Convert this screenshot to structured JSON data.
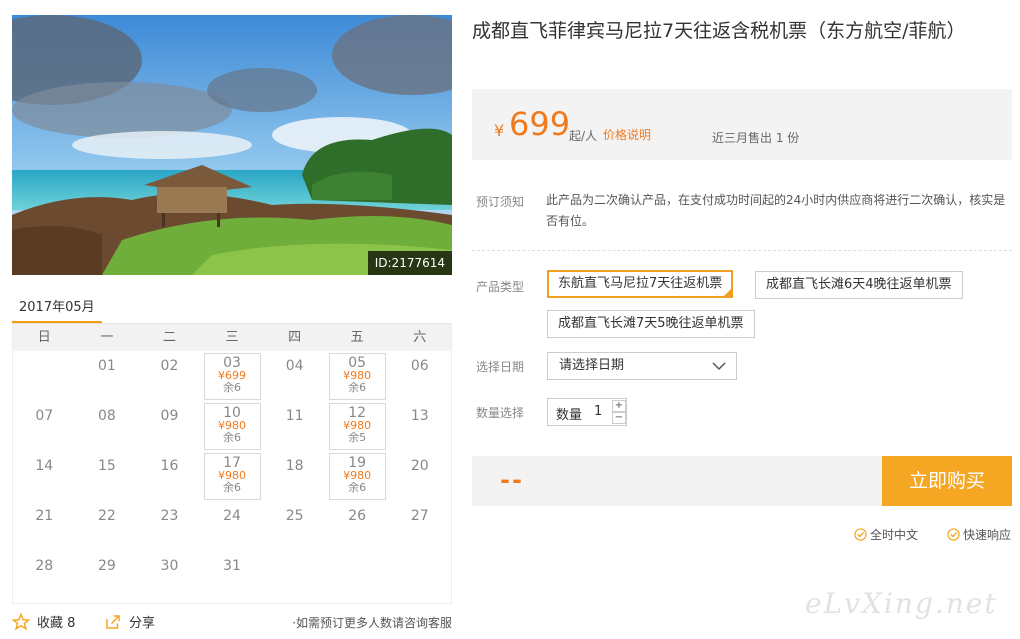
{
  "product": {
    "title": "成都直飞菲律宾马尼拉7天往返含税机票（东方航空/菲航）",
    "image_id": "ID:2177614"
  },
  "price": {
    "currency": "¥",
    "amount": "699",
    "unit": "起/人",
    "detail_link": "价格说明",
    "sold": "近三月售出 1 份"
  },
  "booking": {
    "notice_label": "预订须知",
    "notice_text": "此产品为二次确认产品，在支付成功时间起的24小时内供应商将进行二次确认，核实是否有位。",
    "type_label": "产品类型",
    "types": [
      {
        "label": "东航直飞马尼拉7天往返机票",
        "selected": true
      },
      {
        "label": "成都直飞长滩6天4晚往返单机票",
        "selected": false
      },
      {
        "label": "成都直飞长滩7天5晚往返单机票",
        "selected": false
      }
    ],
    "date_label": "选择日期",
    "date_placeholder": "请选择日期",
    "qty_label": "数量选择",
    "qty_inner": "数量",
    "qty_value": "1",
    "plus": "+",
    "minus": "−",
    "total": "--",
    "buy": "立即购买",
    "guarantees": [
      "全时中文",
      "快速响应"
    ]
  },
  "calendar": {
    "month": "2017年05月",
    "weekdays": [
      "日",
      "一",
      "二",
      "三",
      "四",
      "五",
      "六"
    ],
    "weeks": [
      [
        {
          "d": ""
        },
        {
          "d": "01"
        },
        {
          "d": "02"
        },
        {
          "d": "03",
          "p": "¥699",
          "r": "余6"
        },
        {
          "d": "04"
        },
        {
          "d": "05",
          "p": "¥980",
          "r": "余6"
        },
        {
          "d": "06"
        }
      ],
      [
        {
          "d": "07"
        },
        {
          "d": "08"
        },
        {
          "d": "09"
        },
        {
          "d": "10",
          "p": "¥980",
          "r": "余6"
        },
        {
          "d": "11"
        },
        {
          "d": "12",
          "p": "¥980",
          "r": "余5"
        },
        {
          "d": "13"
        }
      ],
      [
        {
          "d": "14"
        },
        {
          "d": "15"
        },
        {
          "d": "16"
        },
        {
          "d": "17",
          "p": "¥980",
          "r": "余6"
        },
        {
          "d": "18"
        },
        {
          "d": "19",
          "p": "¥980",
          "r": "余6"
        },
        {
          "d": "20"
        }
      ],
      [
        {
          "d": "21"
        },
        {
          "d": "22"
        },
        {
          "d": "23"
        },
        {
          "d": "24"
        },
        {
          "d": "25"
        },
        {
          "d": "26"
        },
        {
          "d": "27"
        }
      ],
      [
        {
          "d": "28"
        },
        {
          "d": "29"
        },
        {
          "d": "30"
        },
        {
          "d": "31"
        },
        {
          "d": ""
        },
        {
          "d": ""
        },
        {
          "d": ""
        }
      ]
    ]
  },
  "footer": {
    "favorite": "收藏 8",
    "share": "分享",
    "note": "·如需预订更多人数请咨询客服"
  },
  "watermark": "eLvXing.net",
  "colors": {
    "accent": "#f07a1e",
    "button": "#f5a623",
    "selected_border": "#f0a020"
  }
}
